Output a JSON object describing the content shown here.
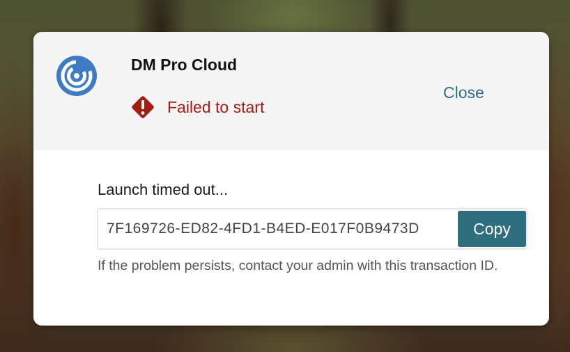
{
  "dialog": {
    "app_name": "DM Pro Cloud",
    "logo_icon": "citrix-spiral-logo",
    "status": {
      "icon": "warning-diamond-icon",
      "text": "Failed to start",
      "color": "#a61c10"
    },
    "close_label": "Close",
    "message": "Launch timed out...",
    "transaction_id": "7F169726-ED82-4FD1-B4ED-E017F0B9473D",
    "copy_label": "Copy",
    "help_text": "If the problem persists, contact your admin with this transaction ID."
  },
  "colors": {
    "accent": "#2e6e7f",
    "link": "#2d6f82",
    "error": "#a61c10",
    "logo": "#3f7ac5"
  }
}
